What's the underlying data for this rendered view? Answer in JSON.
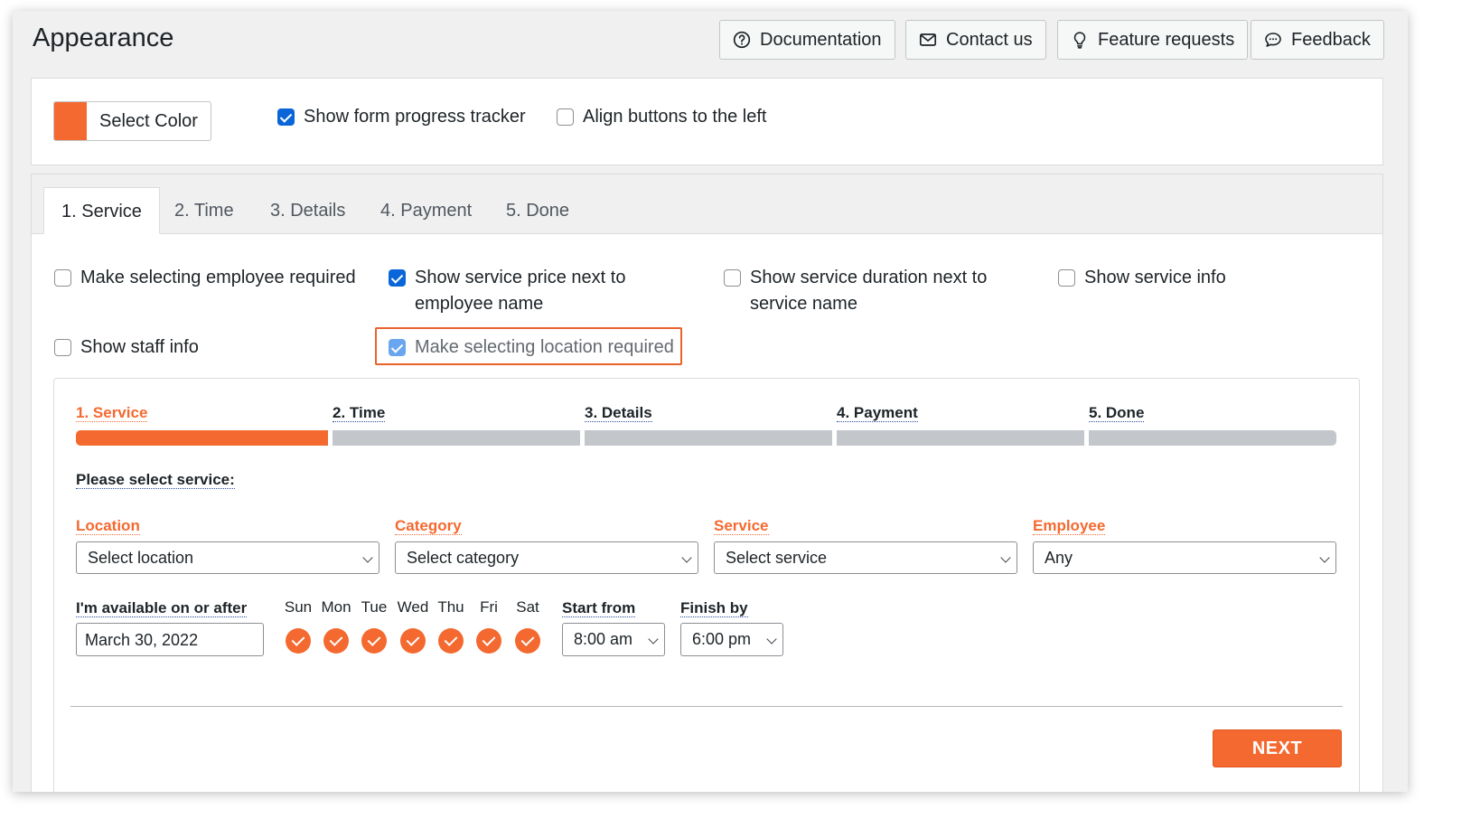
{
  "page": {
    "title": "Appearance"
  },
  "header_buttons": [
    {
      "label": "Documentation",
      "icon": "question-circle-icon"
    },
    {
      "label": "Contact us",
      "icon": "envelope-icon"
    },
    {
      "label": "Feature requests",
      "icon": "lightbulb-icon"
    },
    {
      "label": "Feedback",
      "icon": "chat-bubble-icon"
    }
  ],
  "settings": {
    "select_color_label": "Select Color",
    "accent_color": "#f4692f",
    "show_progress_tracker": {
      "label": "Show form progress tracker",
      "checked": true
    },
    "align_buttons_left": {
      "label": "Align buttons to the left",
      "checked": false
    }
  },
  "tabs": [
    {
      "label": "1. Service",
      "active": true
    },
    {
      "label": "2. Time",
      "active": false
    },
    {
      "label": "3. Details",
      "active": false
    },
    {
      "label": "4. Payment",
      "active": false
    },
    {
      "label": "5. Done",
      "active": false
    }
  ],
  "service_options": {
    "employee_required": {
      "label": "Make selecting employee required",
      "checked": false
    },
    "show_price_line1": "Show service price next to",
    "show_price_line2": "employee name",
    "show_price_checked": true,
    "show_duration_line1": "Show service duration next to",
    "show_duration_line2": "service name",
    "show_duration_checked": false,
    "show_service_info": {
      "label": "Show service info",
      "checked": false
    },
    "show_staff_info": {
      "label": "Show staff info",
      "checked": false
    },
    "location_required": {
      "label": "Make selecting location required",
      "checked": true
    }
  },
  "preview": {
    "steps": [
      "1. Service",
      "2. Time",
      "3. Details",
      "4. Payment",
      "5. Done"
    ],
    "progress": {
      "current_step": 1,
      "total_steps": 5
    },
    "please_select": "Please select service:",
    "fields": {
      "location": {
        "label": "Location",
        "value": "Select location"
      },
      "category": {
        "label": "Category",
        "value": "Select category"
      },
      "service": {
        "label": "Service",
        "value": "Select service"
      },
      "employee": {
        "label": "Employee",
        "value": "Any"
      }
    },
    "available_label": "I'm available on or after",
    "date_value": "March 30, 2022",
    "days": [
      "Sun",
      "Mon",
      "Tue",
      "Wed",
      "Thu",
      "Fri",
      "Sat"
    ],
    "start_from": {
      "label": "Start from",
      "value": "8:00 am"
    },
    "finish_by": {
      "label": "Finish by",
      "value": "6:00 pm"
    },
    "next_label": "NEXT"
  }
}
